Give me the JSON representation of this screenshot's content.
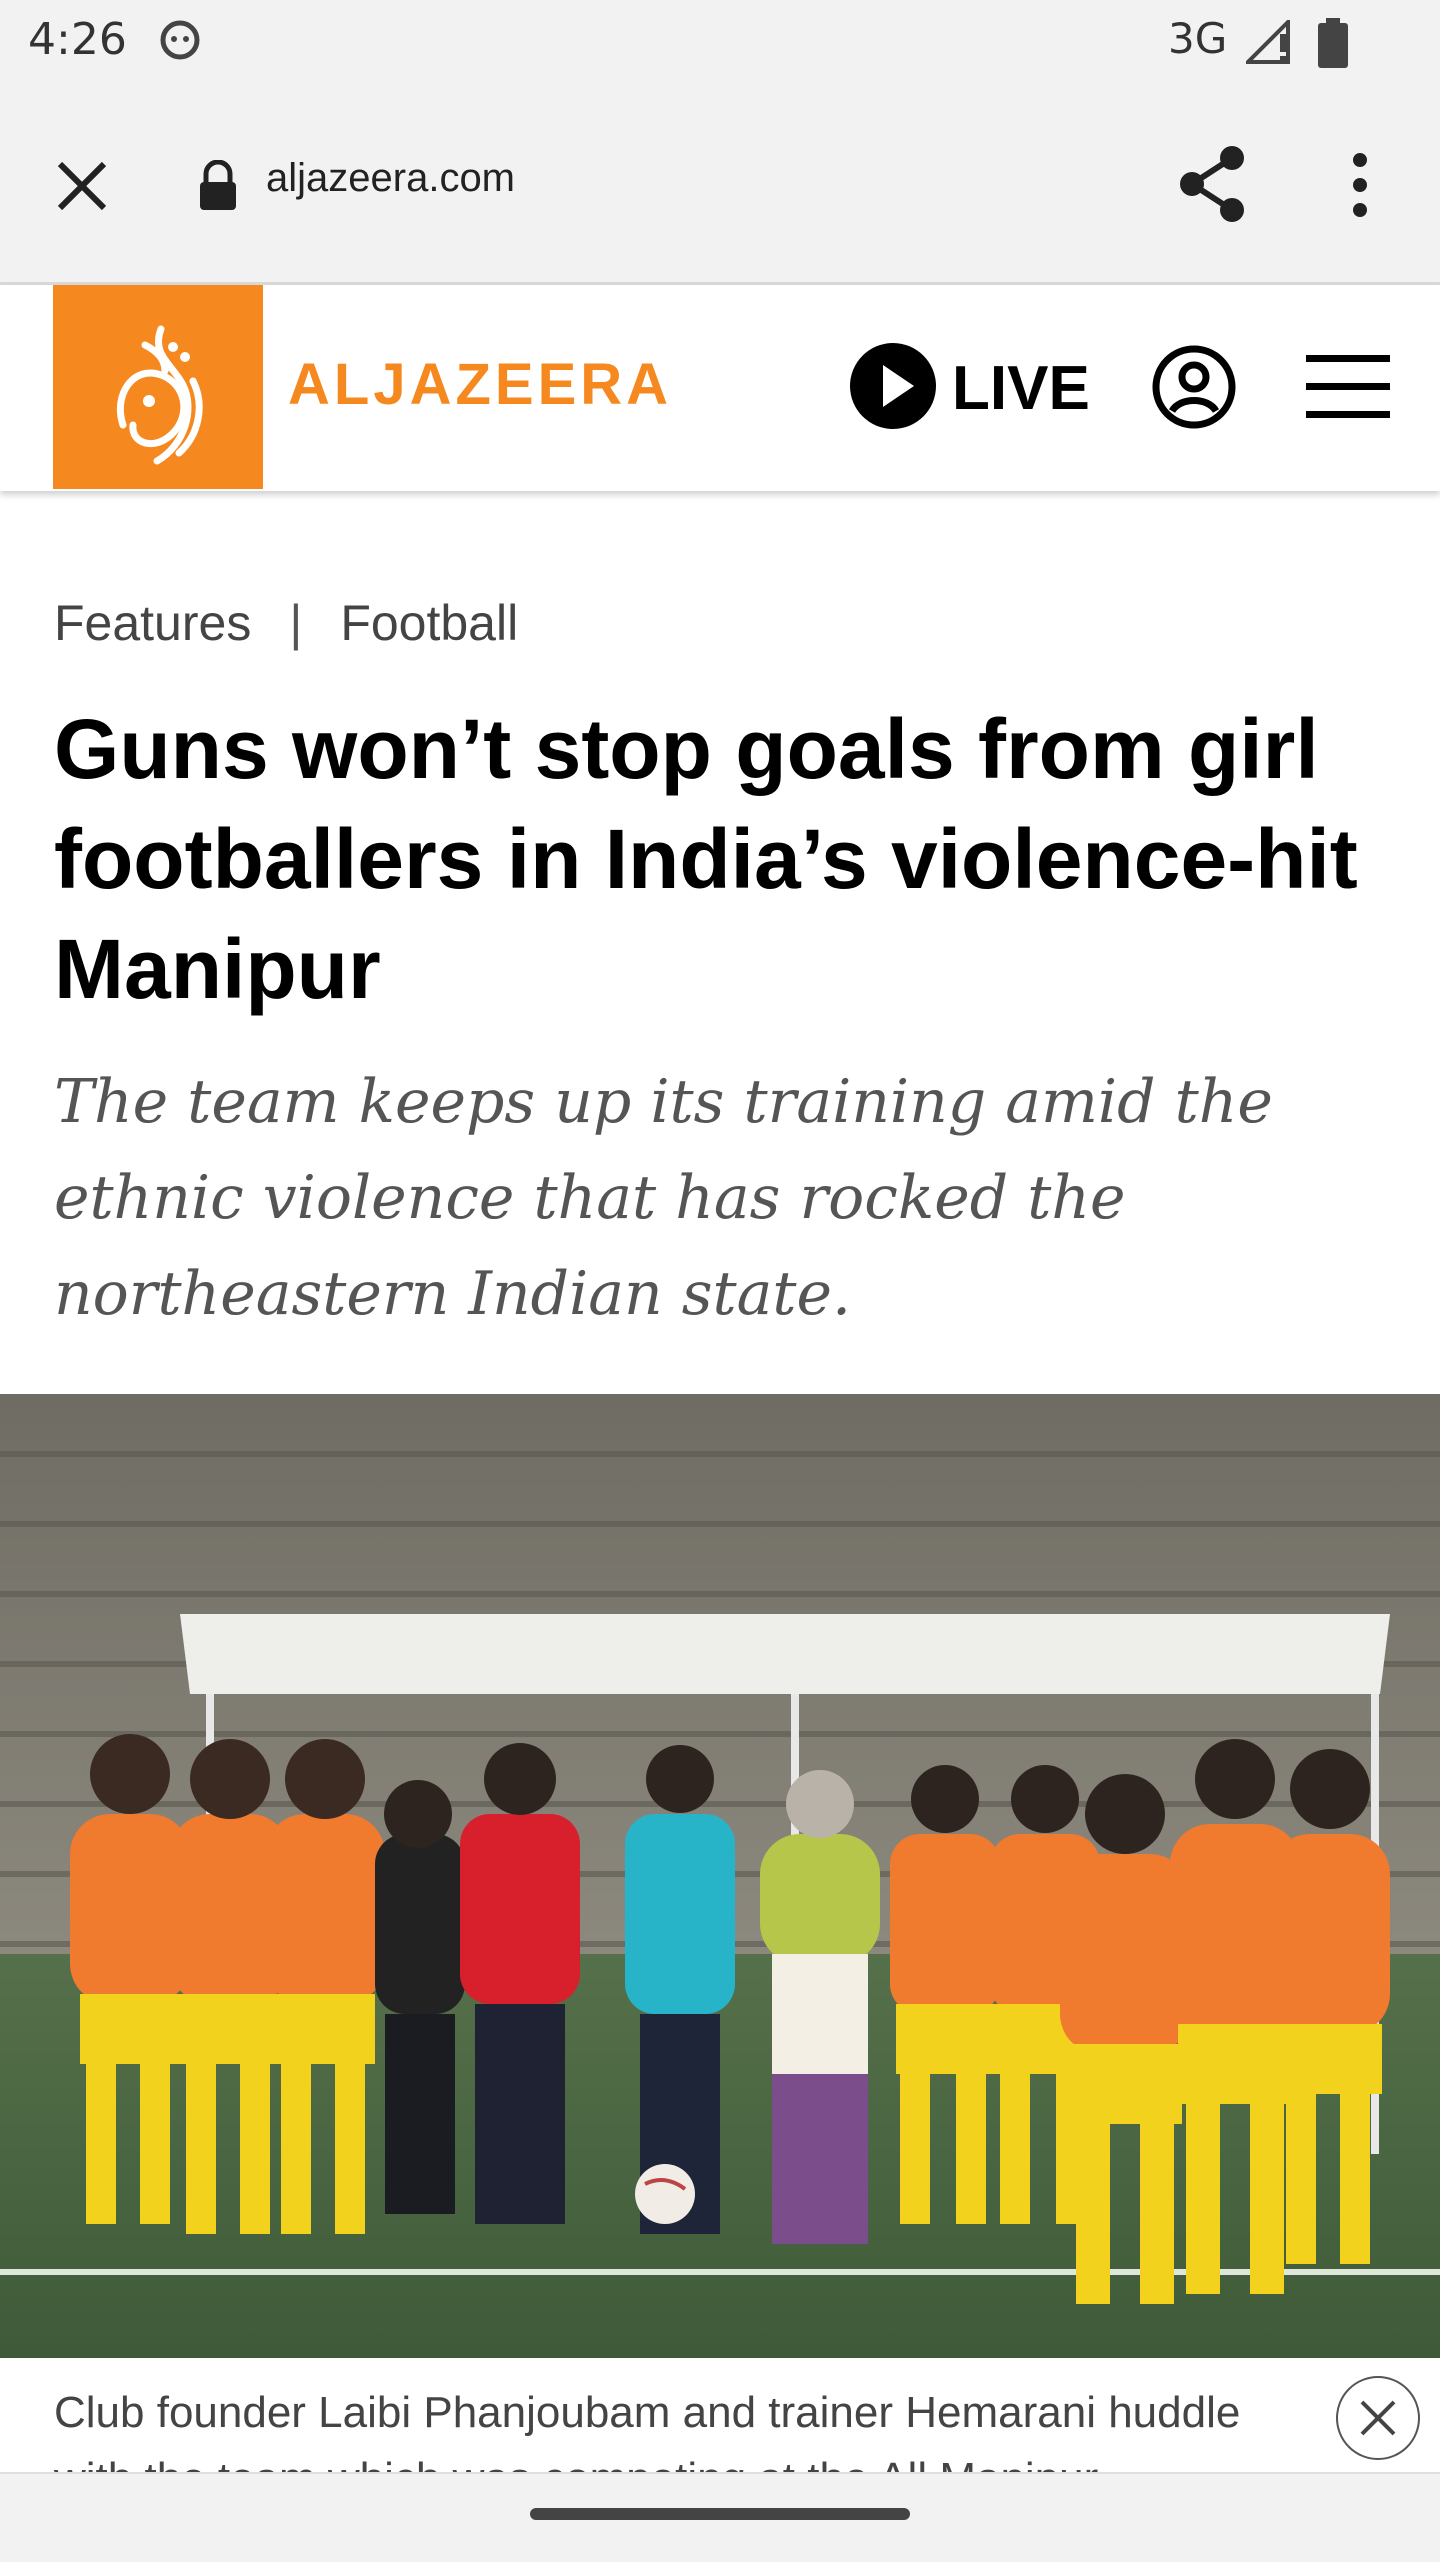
{
  "status_bar": {
    "time": "4:26",
    "network": "3G"
  },
  "browser": {
    "url": "aljazeera.com"
  },
  "site": {
    "brand_name": "ALJAZEERA",
    "live_label": "LIVE",
    "accent": "#f5891f"
  },
  "article": {
    "breadcrumb": [
      "Features",
      "Football"
    ],
    "breadcrumb_separator": "|",
    "title": "Guns won’t stop goals from girl footballers in India’s violence-hit Manipur",
    "subtitle": "The team keeps up its training amid the ethnic violence that has rocked the northeastern Indian state.",
    "caption_line1": "Club founder Laibi Phanjoubam and trainer Hemarani huddle",
    "caption_line2": "with the team which was competing at the All Manipur"
  }
}
